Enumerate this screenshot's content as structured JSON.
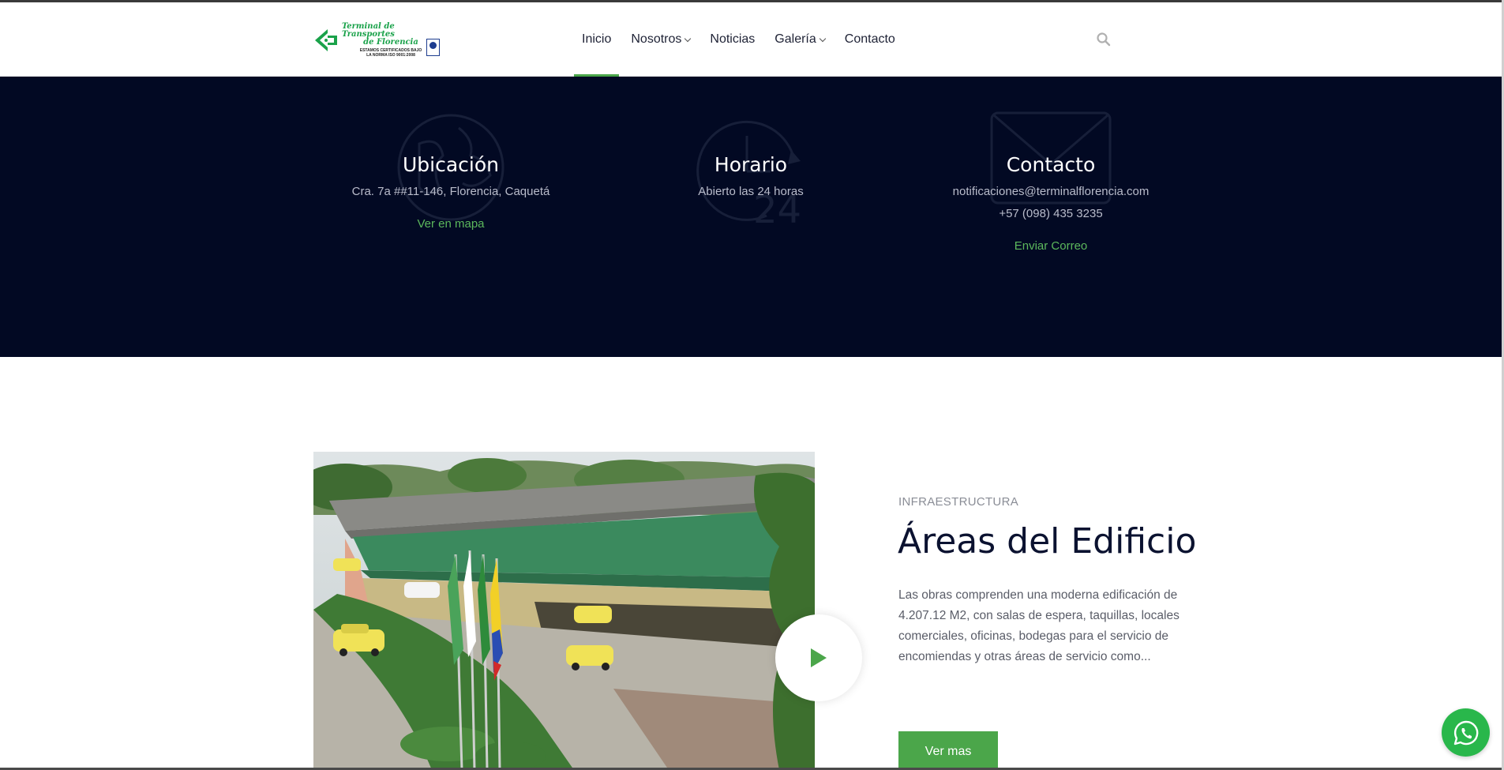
{
  "header": {
    "logo": {
      "title_line1": "Terminal de Transportes",
      "title_line2": "de Florencia",
      "sub_line1": "ESTAMOS CERTIFICADOS BAJO",
      "sub_line2": "LA NORMA ISO 9001:2008",
      "icon": "terminal-logo"
    },
    "nav": [
      {
        "label": "Inicio",
        "active": true,
        "dropdown": false
      },
      {
        "label": "Nosotros",
        "active": false,
        "dropdown": true
      },
      {
        "label": "Noticias",
        "active": false,
        "dropdown": false
      },
      {
        "label": "Galería",
        "active": false,
        "dropdown": true
      },
      {
        "label": "Contacto",
        "active": false,
        "dropdown": false
      }
    ],
    "search_icon": "search-icon"
  },
  "info": {
    "location": {
      "title": "Ubicación",
      "line1": "Cra. 7a ##11-146, Florencia, Caquetá",
      "link": "Ver en mapa",
      "icon": "globe-icon"
    },
    "hours": {
      "title": "Horario",
      "line1": "Abierto las 24 horas",
      "icon": "clock-24-icon"
    },
    "contact": {
      "title": "Contacto",
      "line1": "notificaciones@terminalflorencia.com",
      "line2": "+57 (098) 435 3235",
      "link": "Enviar Correo",
      "icon": "envelope-icon"
    }
  },
  "feature": {
    "eyebrow": "INFRAESTRUCTURA",
    "heading": "Áreas del Edificio",
    "description": "Las obras comprenden una moderna edificación de 4.207.12 M2, con salas de espera, taquillas, locales comerciales, oficinas, bodegas para el servicio de encomiendas y otras áreas de servicio como...",
    "button": "Ver mas",
    "play_icon": "play-icon"
  },
  "floating": {
    "whatsapp_icon": "whatsapp-icon"
  },
  "colors": {
    "accent_green": "#4ba64a",
    "dark_band": "#020923",
    "heading": "#0b1230"
  }
}
